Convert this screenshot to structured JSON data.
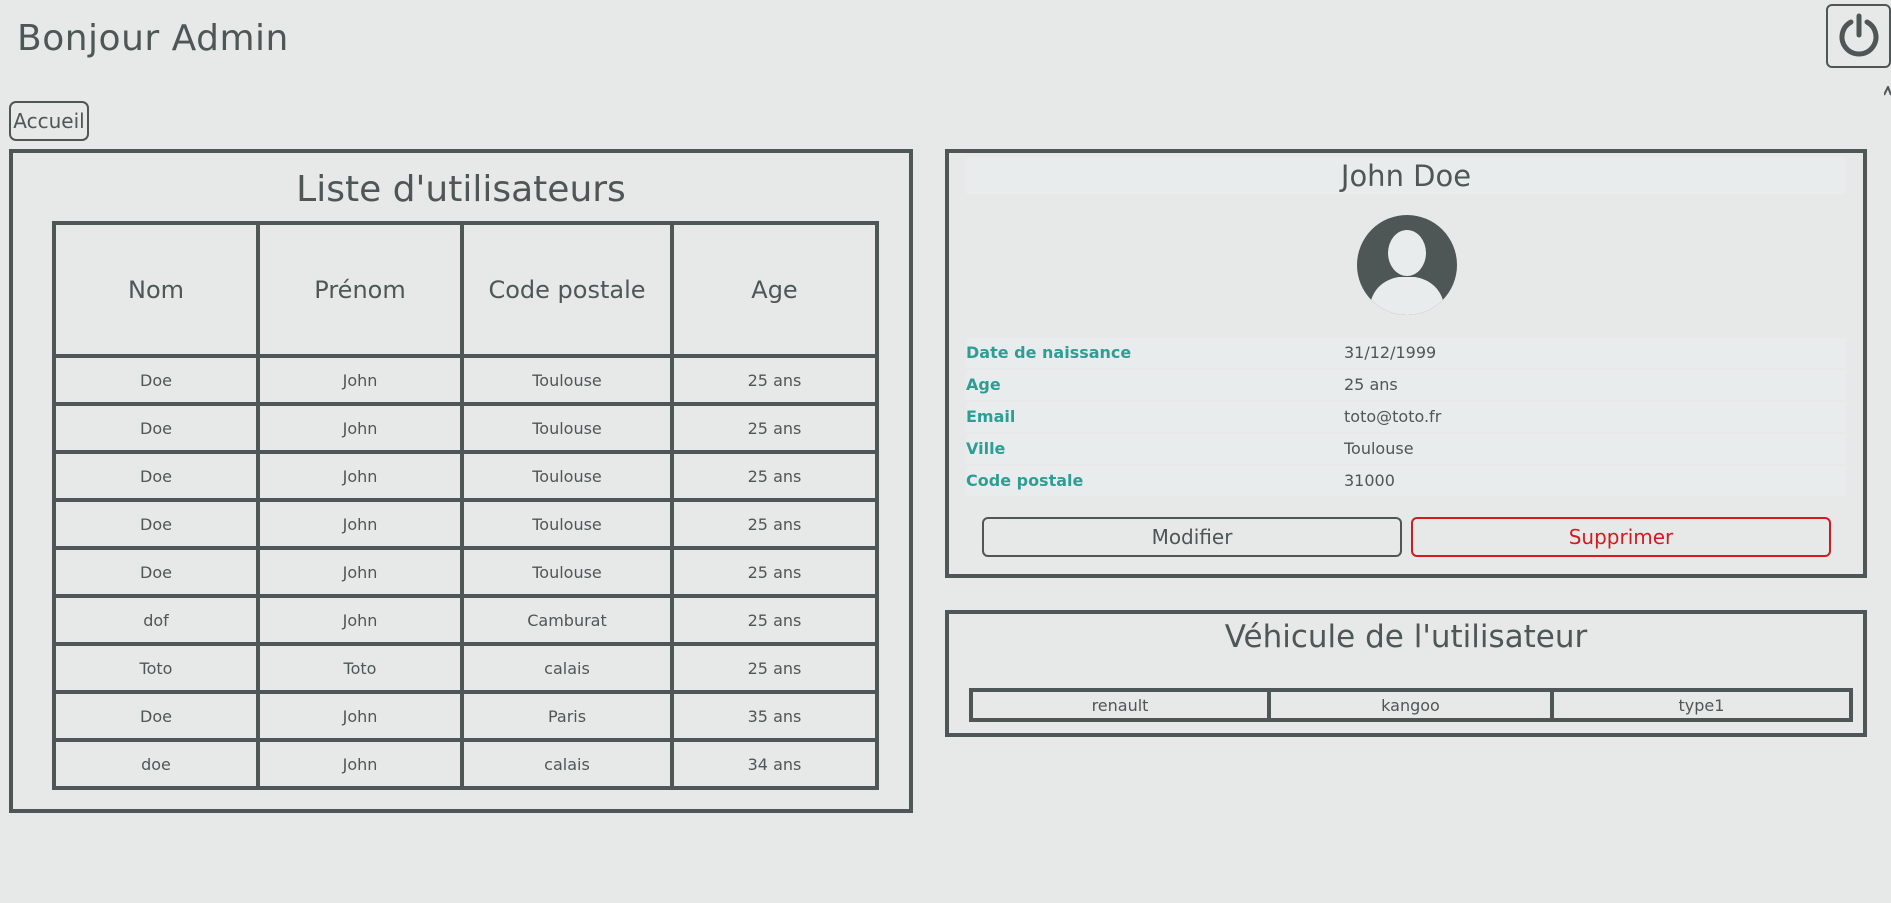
{
  "header": {
    "greeting": "Bonjour Admin",
    "power_icon": "power-icon"
  },
  "nav": {
    "home_label": "Accueil"
  },
  "user_list": {
    "title": "Liste d'utilisateurs",
    "columns": [
      "Nom",
      "Prénom",
      "Code postale",
      "Age"
    ],
    "rows": [
      [
        "Doe",
        "John",
        "Toulouse",
        "25 ans"
      ],
      [
        "Doe",
        "John",
        "Toulouse",
        "25 ans"
      ],
      [
        "Doe",
        "John",
        "Toulouse",
        "25 ans"
      ],
      [
        "Doe",
        "John",
        "Toulouse",
        "25 ans"
      ],
      [
        "Doe",
        "John",
        "Toulouse",
        "25 ans"
      ],
      [
        "dof",
        "John",
        "Camburat",
        "25 ans"
      ],
      [
        "Toto",
        "Toto",
        "calais",
        "25 ans"
      ],
      [
        "Doe",
        "John",
        "Paris",
        "35 ans"
      ],
      [
        "doe",
        "John",
        "calais",
        "34 ans"
      ]
    ]
  },
  "user_detail": {
    "name": "John Doe",
    "avatar_icon": "user-avatar-icon",
    "fields": [
      {
        "label": "Date de naissance",
        "value": "31/12/1999"
      },
      {
        "label": "Age",
        "value": "25 ans"
      },
      {
        "label": "Email",
        "value": "toto@toto.fr"
      },
      {
        "label": "Ville",
        "value": "Toulouse"
      },
      {
        "label": "Code postale",
        "value": "31000"
      }
    ],
    "edit_label": "Modifier",
    "delete_label": "Supprimer"
  },
  "vehicle": {
    "title": "Véhicule de l'utilisateur",
    "rows": [
      [
        "renault",
        "kangoo",
        "type1"
      ]
    ]
  },
  "colors": {
    "background": "#e6e9e8",
    "text": "#4f5656",
    "accent_label": "#2e9e95",
    "danger": "#d7191f"
  }
}
